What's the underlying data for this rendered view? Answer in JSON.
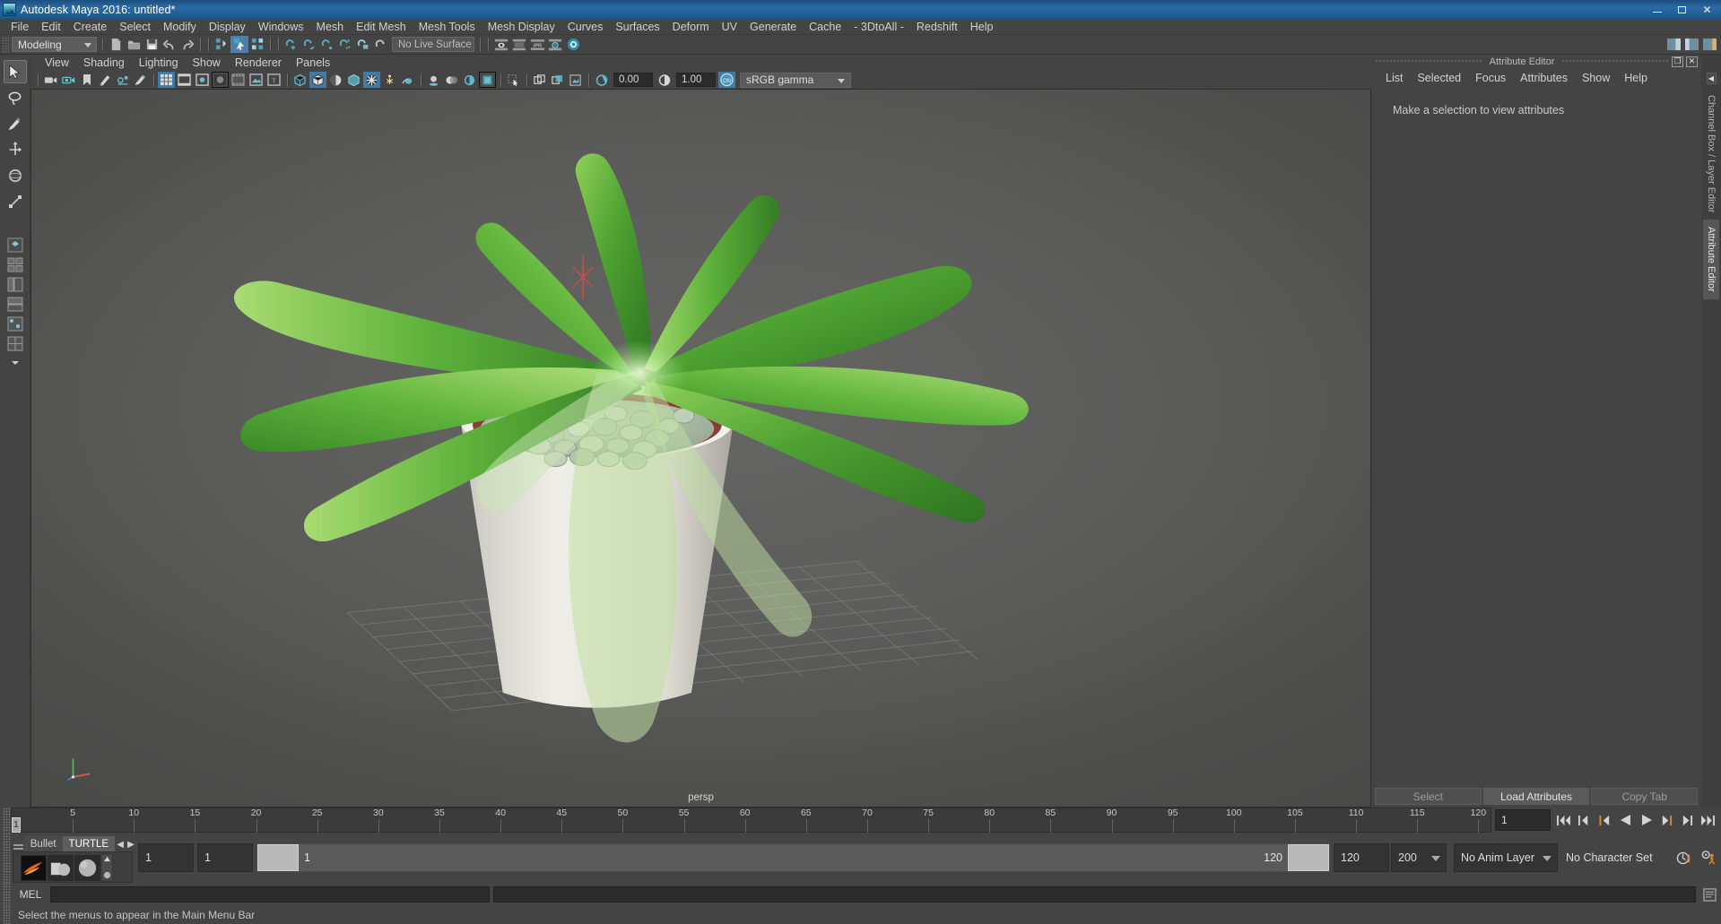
{
  "window": {
    "title": "Autodesk Maya 2016: untitled*",
    "icon": "maya-logo-icon",
    "minimize_label": "–",
    "maximize_label": "❐",
    "close_label": "✕"
  },
  "main_menu": {
    "items": [
      "File",
      "Edit",
      "Create",
      "Select",
      "Modify",
      "Display",
      "Windows",
      "Mesh",
      "Edit Mesh",
      "Mesh Tools",
      "Mesh Display",
      "Curves",
      "Surfaces",
      "Deform",
      "UV",
      "Generate",
      "Cache",
      "- 3DtoAll -",
      "Redshift",
      "Help"
    ]
  },
  "status_toolbar": {
    "mode": "Modeling",
    "live_surface": "No Live Surface",
    "icons": [
      "new-scene-icon",
      "open-scene-icon",
      "save-scene-icon",
      "undo-icon",
      "redo-icon",
      "select-hierarchy-icon",
      "select-object-icon",
      "select-component-icon",
      "snap-grid-icon",
      "snap-curve-icon",
      "snap-point-icon",
      "snap-projected-center-icon",
      "snap-view-plane-icon",
      "make-live-icon",
      "render-view-icon",
      "render-sequence-icon",
      "ipr-render-icon",
      "render-settings-icon",
      "hypershade-icon",
      "attribute-editor-toggle-icon",
      "tool-settings-toggle-icon",
      "channel-box-toggle-icon"
    ]
  },
  "toolbox": {
    "tools": [
      {
        "name": "select-tool",
        "selected": true
      },
      {
        "name": "lasso-select-tool",
        "selected": false
      },
      {
        "name": "paint-select-tool",
        "selected": false
      },
      {
        "name": "move-tool",
        "selected": false
      },
      {
        "name": "rotate-tool",
        "selected": false
      },
      {
        "name": "scale-tool",
        "selected": false
      }
    ],
    "layout_buttons": [
      "single-perspective-layout-icon",
      "four-view-layout-icon",
      "persp-outliner-layout-icon",
      "persp-graph-layout-icon",
      "persp-hypershade-layout-icon",
      "persp-uv-layout-icon",
      "more-layouts-icon"
    ]
  },
  "viewport": {
    "menu": [
      "View",
      "Shading",
      "Lighting",
      "Show",
      "Renderer",
      "Panels"
    ],
    "camera_label": "persp",
    "exposure_value": "0.00",
    "gamma_value": "1.00",
    "color_management": "sRGB gamma",
    "toolbar_icons": [
      "select-camera-icon",
      "camera-attributes-icon",
      "bookmark-icon",
      "image-plane-icon",
      "two-sided-lighting-icon",
      "grease-pencil-icon",
      "grid-toggle-icon",
      "film-gate-icon",
      "resolution-gate-icon",
      "gate-mask-icon",
      "film-origin-icon",
      "region-icon",
      "safe-title-icon",
      "wireframe-shading-icon",
      "smooth-shading-icon",
      "smooth-shade-all-icon",
      "shaded-textured-icon",
      "wireframe-on-shaded-icon",
      "texture-toggle-icon",
      "lighting-toggle-icon",
      "shadows-toggle-icon",
      "screen-space-ao-icon",
      "motion-blur-icon",
      "multisample-icon",
      "depth-of-field-icon",
      "isolate-select-icon",
      "xray-icon",
      "xray-joints-icon",
      "xray-active-icon",
      "exposure-icon",
      "gamma-icon",
      "color-management-toggle-icon"
    ],
    "scene_description": "Potted plant with broad green leaves on a ground grid"
  },
  "attribute_editor": {
    "panel_title": "Attribute Editor",
    "menu": [
      "List",
      "Selected",
      "Focus",
      "Attributes",
      "Show",
      "Help"
    ],
    "empty_message": "Make a selection to view attributes",
    "buttons": [
      {
        "label": "Select",
        "enabled": false
      },
      {
        "label": "Load Attributes",
        "enabled": true
      },
      {
        "label": "Copy Tab",
        "enabled": false
      }
    ],
    "side_tabs": [
      {
        "label": "Channel Box / Layer Editor",
        "selected": false
      },
      {
        "label": "Attribute Editor",
        "selected": true
      }
    ],
    "float_icon": "undock-panel-icon",
    "close_icon": "close-panel-icon"
  },
  "time_slider": {
    "ticks": [
      5,
      10,
      15,
      20,
      25,
      30,
      35,
      40,
      45,
      50,
      55,
      60,
      65,
      70,
      75,
      80,
      85,
      90,
      95,
      100,
      105,
      110,
      115,
      120
    ],
    "current_frame_marker": "1",
    "current_frame_field": "1",
    "playback_buttons": [
      "go-to-start-icon",
      "step-back-frame-icon",
      "step-back-key-icon",
      "play-backwards-icon",
      "play-forwards-icon",
      "step-forward-key-icon",
      "step-forward-frame-icon",
      "go-to-end-icon"
    ]
  },
  "range_slider": {
    "shelf": {
      "tabs": [
        "Bullet",
        "TURTLE"
      ],
      "selected_tab": "TURTLE",
      "prev_arrow": "◀",
      "next_arrow": "▶",
      "icons": [
        "turtle-render-icon",
        "turtle-bake-icon",
        "turtle-sphere-icon"
      ]
    },
    "start_time": "1",
    "playback_start": "1",
    "range_bar_start_label": "1",
    "range_bar_end_label": "120",
    "playback_end": "120",
    "end_time": "200",
    "anim_layer": "No Anim Layer",
    "character_set": "No Character Set",
    "auto_key_icon": "auto-keyframe-icon",
    "animation_prefs_icon": "animation-preferences-icon"
  },
  "command_line": {
    "language_label": "MEL",
    "input_value": "",
    "input_placeholder": "",
    "output_value": "",
    "script_editor_icon": "script-editor-icon"
  },
  "help_line": {
    "text": "Select the menus to appear in the Main Menu Bar"
  },
  "colors": {
    "window_bg": "#444444",
    "title_blue": "#2a6ba5",
    "accent_blue": "#4f7fa8",
    "field_dark": "#2b2b2b",
    "text": "#c8c8c8",
    "teal_icon": "#3aa6b9",
    "orange": "#e08828"
  }
}
